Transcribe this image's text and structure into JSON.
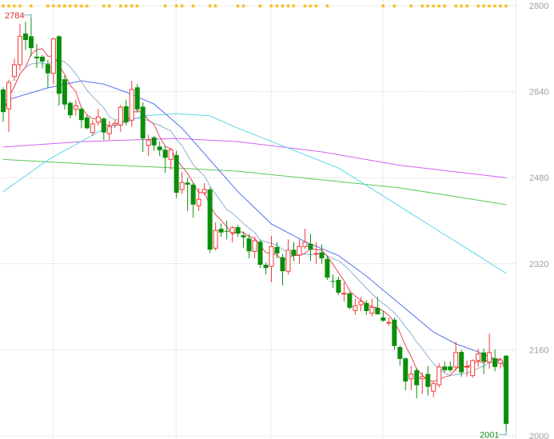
{
  "chart_data": {
    "type": "candlestick",
    "title": "",
    "ylim": [
      2000,
      2800
    ],
    "y_ticks": [
      2800,
      2640,
      2480,
      2320,
      2160,
      2000
    ],
    "y_tick_labels": [
      "2800",
      "2640",
      "2480",
      "2320",
      "2160",
      "2000"
    ],
    "grid": true,
    "vertical_grid_at_index": [
      9,
      31,
      48,
      68
    ],
    "colors": {
      "up": "#f23b3b",
      "down": "#0b8f0b",
      "ma5": "#e8485a",
      "ma10": "#8fb0d0",
      "ma20": "#5570f0",
      "ma60": "#58d8e8",
      "ma120": "#5ac85a",
      "ma250": "#d060f0",
      "marker": "#f5b400",
      "grid": "#d0d0d0"
    },
    "candles_ohlc": [
      [
        2644,
        2648,
        2584,
        2602
      ],
      [
        2608,
        2662,
        2565,
        2657
      ],
      [
        2668,
        2702,
        2660,
        2690
      ],
      [
        2690,
        2766,
        2680,
        2743
      ],
      [
        2748,
        2770,
        2717,
        2736
      ],
      [
        2743,
        2784,
        2706,
        2721
      ],
      [
        2705,
        2729,
        2684,
        2702
      ],
      [
        2705,
        2708,
        2683,
        2696
      ],
      [
        2691,
        2699,
        2647,
        2674
      ],
      [
        2674,
        2740,
        2654,
        2738
      ],
      [
        2743,
        2745,
        2614,
        2636
      ],
      [
        2663,
        2670,
        2607,
        2616
      ],
      [
        2619,
        2622,
        2590,
        2596
      ],
      [
        2607,
        2625,
        2595,
        2614
      ],
      [
        2608,
        2612,
        2572,
        2587
      ],
      [
        2592,
        2596,
        2570,
        2572
      ],
      [
        2564,
        2587,
        2558,
        2580
      ],
      [
        2583,
        2608,
        2577,
        2593
      ],
      [
        2590,
        2592,
        2550,
        2564
      ],
      [
        2562,
        2585,
        2550,
        2575
      ],
      [
        2578,
        2587,
        2572,
        2581
      ],
      [
        2578,
        2615,
        2565,
        2611
      ],
      [
        2613,
        2625,
        2577,
        2583
      ],
      [
        2587,
        2660,
        2575,
        2644
      ],
      [
        2648,
        2654,
        2600,
        2607
      ],
      [
        2612,
        2620,
        2528,
        2553
      ],
      [
        2540,
        2560,
        2520,
        2550
      ],
      [
        2555,
        2558,
        2530,
        2540
      ],
      [
        2538,
        2548,
        2520,
        2531
      ],
      [
        2532,
        2540,
        2489,
        2517
      ],
      [
        2514,
        2535,
        2495,
        2532
      ],
      [
        2522,
        2530,
        2442,
        2452
      ],
      [
        2458,
        2491,
        2450,
        2471
      ],
      [
        2471,
        2480,
        2418,
        2467
      ],
      [
        2467,
        2470,
        2406,
        2430
      ],
      [
        2428,
        2460,
        2418,
        2440
      ],
      [
        2452,
        2470,
        2448,
        2458
      ],
      [
        2458,
        2462,
        2340,
        2346
      ],
      [
        2349,
        2397,
        2345,
        2382
      ],
      [
        2385,
        2395,
        2370,
        2378
      ],
      [
        2381,
        2400,
        2365,
        2380
      ],
      [
        2378,
        2390,
        2360,
        2387
      ],
      [
        2388,
        2392,
        2370,
        2376
      ],
      [
        2373,
        2380,
        2350,
        2369
      ],
      [
        2367,
        2375,
        2330,
        2343
      ],
      [
        2343,
        2370,
        2330,
        2363
      ],
      [
        2361,
        2365,
        2312,
        2318
      ],
      [
        2318,
        2322,
        2300,
        2312
      ],
      [
        2315,
        2372,
        2286,
        2352
      ],
      [
        2351,
        2360,
        2330,
        2339
      ],
      [
        2332,
        2338,
        2280,
        2306
      ],
      [
        2306,
        2365,
        2300,
        2345
      ],
      [
        2346,
        2360,
        2325,
        2335
      ],
      [
        2336,
        2365,
        2320,
        2352
      ],
      [
        2352,
        2385,
        2348,
        2360
      ],
      [
        2357,
        2375,
        2325,
        2346
      ],
      [
        2339,
        2360,
        2320,
        2339
      ],
      [
        2341,
        2356,
        2320,
        2330
      ],
      [
        2329,
        2335,
        2290,
        2294
      ],
      [
        2288,
        2300,
        2275,
        2287
      ],
      [
        2290,
        2296,
        2262,
        2266
      ],
      [
        2265,
        2285,
        2250,
        2265
      ],
      [
        2265,
        2268,
        2235,
        2238
      ],
      [
        2233,
        2255,
        2225,
        2242
      ],
      [
        2244,
        2258,
        2232,
        2250
      ],
      [
        2247,
        2252,
        2225,
        2232
      ],
      [
        2228,
        2255,
        2222,
        2239
      ],
      [
        2238,
        2258,
        2225,
        2226
      ],
      [
        2220,
        2232,
        2212,
        2214
      ],
      [
        2211,
        2220,
        2205,
        2211
      ],
      [
        2216,
        2220,
        2160,
        2167
      ],
      [
        2165,
        2168,
        2130,
        2143
      ],
      [
        2144,
        2146,
        2085,
        2101
      ],
      [
        2106,
        2130,
        2085,
        2115
      ],
      [
        2122,
        2126,
        2070,
        2094
      ],
      [
        2106,
        2118,
        2078,
        2110
      ],
      [
        2115,
        2130,
        2075,
        2091
      ],
      [
        2083,
        2100,
        2072,
        2097
      ],
      [
        2095,
        2135,
        2090,
        2128
      ],
      [
        2129,
        2138,
        2118,
        2122
      ],
      [
        2129,
        2138,
        2118,
        2122
      ],
      [
        2128,
        2175,
        2120,
        2155
      ],
      [
        2156,
        2160,
        2110,
        2118
      ],
      [
        2129,
        2140,
        2110,
        2129
      ],
      [
        2112,
        2142,
        2108,
        2140
      ],
      [
        2140,
        2162,
        2128,
        2152
      ],
      [
        2155,
        2162,
        2115,
        2138
      ],
      [
        2137,
        2190,
        2125,
        2155
      ],
      [
        2144,
        2160,
        2120,
        2128
      ],
      [
        2135,
        2145,
        2125,
        2141
      ],
      [
        2149,
        2150,
        2001,
        2022
      ]
    ],
    "moving_averages": {
      "ma20": [
        [
          0,
          2622
        ],
        [
          4,
          2635
        ],
        [
          8,
          2647
        ],
        [
          14,
          2660
        ],
        [
          18,
          2654
        ],
        [
          22,
          2639
        ],
        [
          27,
          2617
        ],
        [
          32,
          2572
        ],
        [
          37,
          2513
        ],
        [
          42,
          2454
        ],
        [
          48,
          2394
        ],
        [
          54,
          2361
        ],
        [
          60,
          2335
        ],
        [
          65,
          2297
        ],
        [
          71,
          2245
        ],
        [
          77,
          2193
        ],
        [
          81,
          2171
        ],
        [
          85,
          2156
        ],
        [
          90,
          2134
        ]
      ],
      "ma60": [
        [
          0,
          2454
        ],
        [
          8,
          2513
        ],
        [
          17,
          2565
        ],
        [
          25,
          2595
        ],
        [
          31,
          2599
        ],
        [
          37,
          2595
        ],
        [
          42,
          2572
        ],
        [
          51,
          2535
        ],
        [
          60,
          2498
        ],
        [
          68,
          2446
        ],
        [
          77,
          2387
        ],
        [
          85,
          2335
        ],
        [
          90,
          2302
        ]
      ],
      "ma120": [
        [
          0,
          2514
        ],
        [
          14,
          2506
        ],
        [
          31,
          2498
        ],
        [
          42,
          2492
        ],
        [
          57,
          2476
        ],
        [
          71,
          2461
        ],
        [
          90,
          2430
        ]
      ],
      "ma250": [
        [
          0,
          2537
        ],
        [
          14,
          2547
        ],
        [
          31,
          2553
        ],
        [
          42,
          2547
        ],
        [
          57,
          2528
        ],
        [
          71,
          2503
        ],
        [
          90,
          2480
        ]
      ]
    },
    "event_marker_indices": [
      0,
      1,
      2,
      3,
      5,
      8,
      9,
      10,
      11,
      12,
      13,
      14,
      15,
      18,
      19,
      21,
      22,
      23,
      24,
      29,
      31,
      32,
      34,
      37,
      38,
      42,
      43,
      46,
      48,
      49,
      50,
      51,
      52,
      54,
      55,
      56,
      58,
      68,
      70,
      73,
      75,
      76,
      77,
      78,
      79,
      81,
      82,
      83,
      85,
      86,
      87,
      88,
      89,
      90
    ],
    "annotations": {
      "high": {
        "label": "2784",
        "value": 2784,
        "index": 5
      },
      "low": {
        "label": "2001",
        "value": 2001,
        "index": 90
      }
    }
  }
}
